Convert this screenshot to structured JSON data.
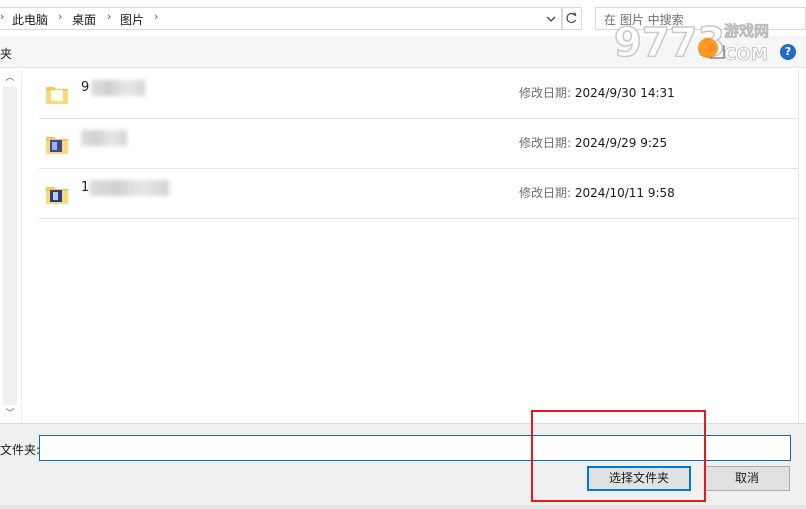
{
  "address_bar": {
    "breadcrumbs": [
      "此电脑",
      "桌面",
      "图片"
    ],
    "separator": "›",
    "search_placeholder": "在 图片 中搜索"
  },
  "toolbar": {
    "partial_label": "夹"
  },
  "icons": {
    "breadcrumb_chevron": "chevron-right-icon",
    "dropdown": "chevron-down-icon",
    "refresh": "refresh-icon",
    "help": "help-icon",
    "view": "view-options-icon",
    "folder": "folder-icon"
  },
  "watermark": {
    "text": "9773",
    "brand": "游戏网",
    "domain": "COM"
  },
  "files": [
    {
      "name_visible": "9",
      "modified_label": "修改日期:",
      "modified_value": "2024/9/30 14:31"
    },
    {
      "name_visible": "",
      "modified_label": "修改日期:",
      "modified_value": "2024/9/29 9:25"
    },
    {
      "name_visible": "1",
      "modified_label": "修改日期:",
      "modified_value": "2024/10/11 9:58"
    }
  ],
  "bottom": {
    "folder_label": "文件夹:",
    "folder_value": "",
    "select_button": "选择文件夹",
    "cancel_button": "取消"
  },
  "colors": {
    "accent": "#0078d4",
    "highlight": "#e8191c",
    "help_blue": "#1f6fc4"
  }
}
